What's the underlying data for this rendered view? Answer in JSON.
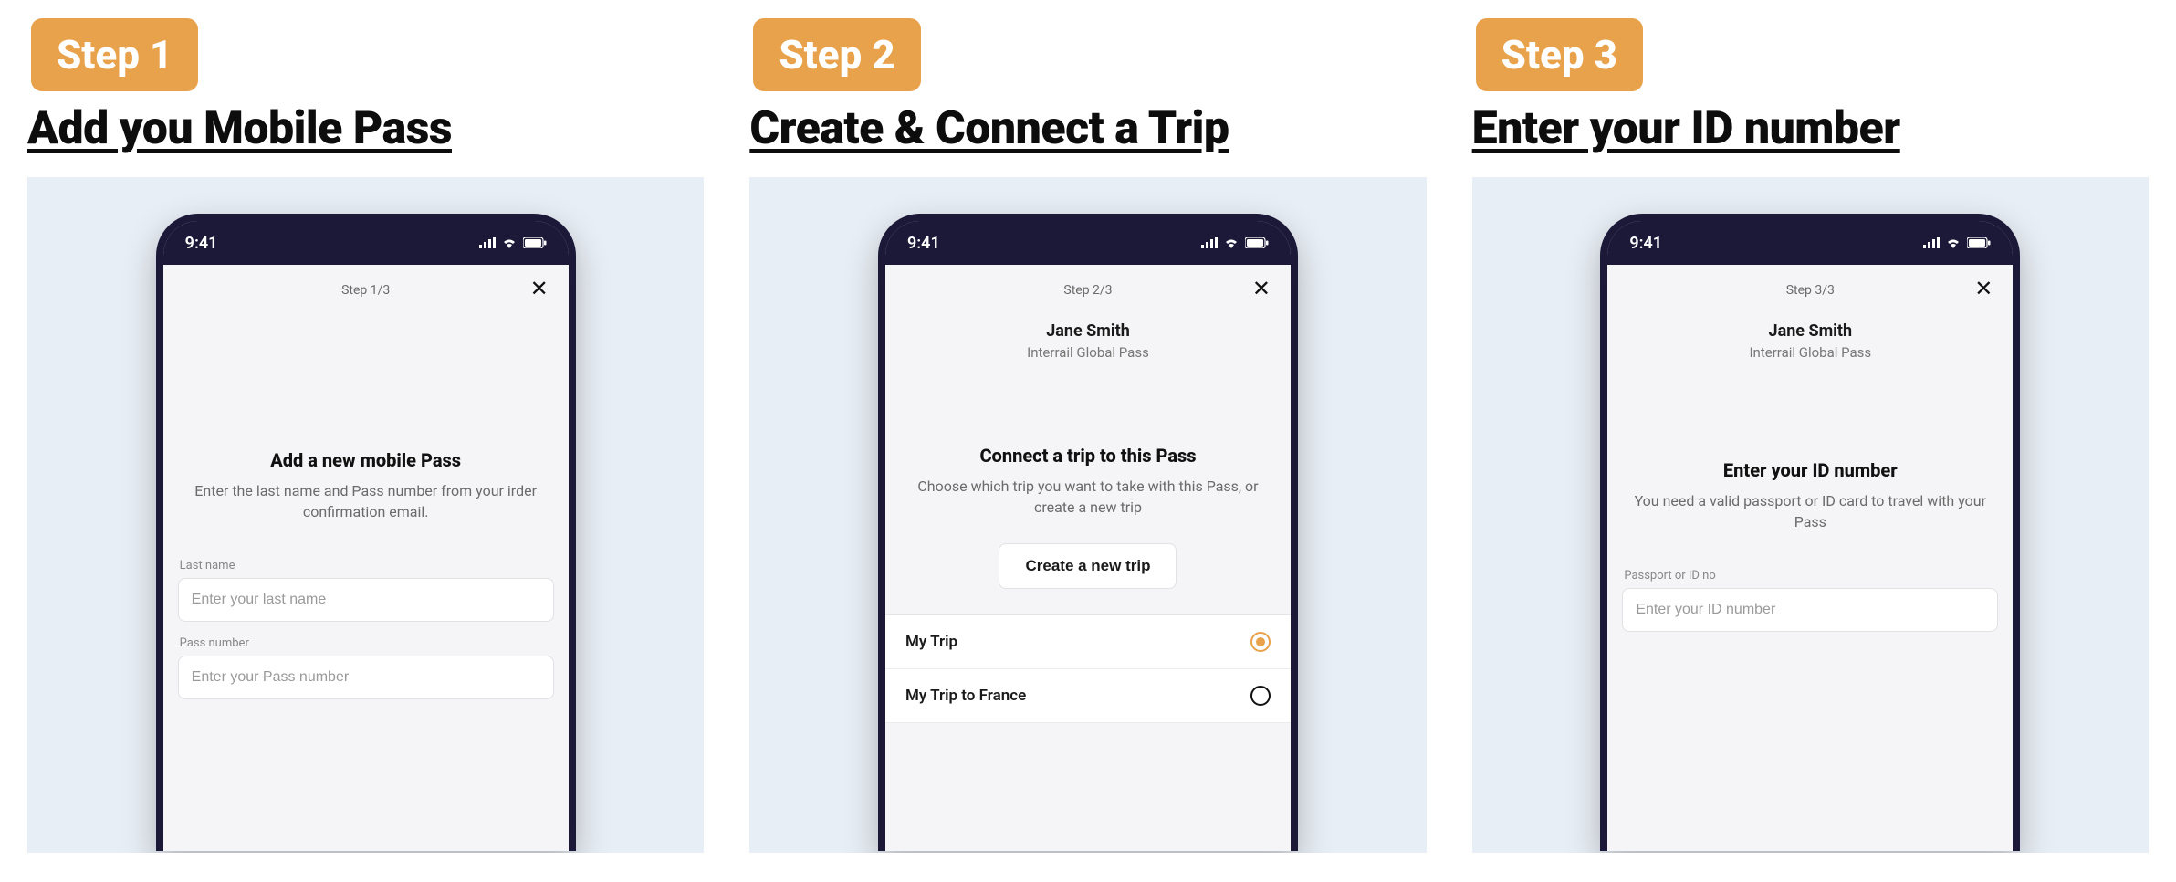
{
  "status": {
    "time": "9:41"
  },
  "columns": [
    {
      "badge": "Step 1",
      "title": "Add you Mobile Pass",
      "screen": {
        "step": "Step 1/3",
        "heading": "Add a new mobile Pass",
        "sub": "Enter the last name and Pass number from your irder confirmation email.",
        "fields": {
          "last_name_label": "Last name",
          "last_name_placeholder": "Enter your last name",
          "pass_label": "Pass number",
          "pass_placeholder": "Enter your Pass number"
        }
      }
    },
    {
      "badge": "Step 2",
      "title": "Create & Connect a Trip",
      "screen": {
        "step": "Step 2/3",
        "user_name": "Jane Smith",
        "pass_type": "Interrail Global Pass",
        "heading": "Connect a trip to this Pass",
        "sub": "Choose which trip you want to take with this Pass, or create a new trip",
        "create_label": "Create a new trip",
        "trips": [
          {
            "label": "My Trip",
            "selected": true
          },
          {
            "label": "My Trip to France",
            "selected": false
          }
        ]
      }
    },
    {
      "badge": "Step 3",
      "title": "Enter your ID number",
      "screen": {
        "step": "Step 3/3",
        "user_name": "Jane Smith",
        "pass_type": "Interrail Global Pass",
        "heading": "Enter your ID number",
        "sub": "You need a valid passport or ID card to travel with your Pass",
        "fields": {
          "id_label": "Passport or ID no",
          "id_placeholder": "Enter your ID number"
        }
      }
    }
  ]
}
